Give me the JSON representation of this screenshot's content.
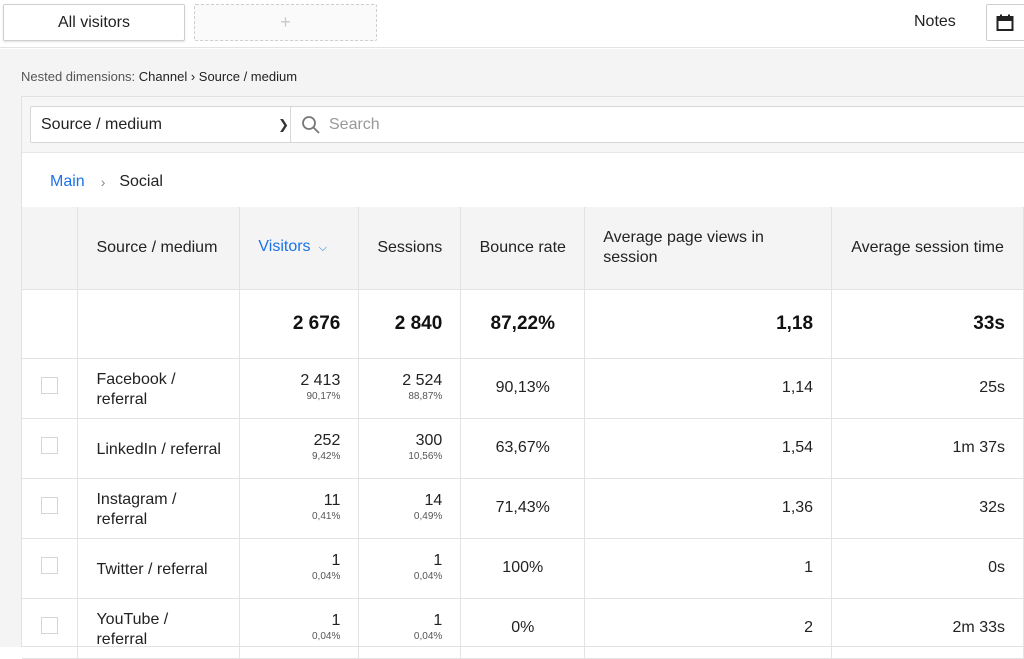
{
  "topbar": {
    "segment_label": "All visitors",
    "add_segment": "+",
    "notes_label": "Notes"
  },
  "nested": {
    "prefix": "Nested dimensions:",
    "path": "Channel › Source / medium"
  },
  "filter": {
    "dimension": "Source / medium",
    "search_placeholder": "Search"
  },
  "breadcrumb": {
    "main": "Main",
    "separator": "›",
    "current": "Social"
  },
  "table": {
    "headers": {
      "source": "Source / medium",
      "visitors": "Visitors",
      "sessions": "Sessions",
      "bounce": "Bounce rate",
      "pageviews": "Average page views in session",
      "session_time": "Average session time"
    },
    "totals": {
      "visitors": "2 676",
      "sessions": "2 840",
      "bounce": "87,22%",
      "pageviews": "1,18",
      "session_time": "33s"
    },
    "rows": [
      {
        "name": "Facebook / referral",
        "visitors": "2 413",
        "visitors_pct": "90,17%",
        "sessions": "2 524",
        "sessions_pct": "88,87%",
        "bounce": "90,13%",
        "pageviews": "1,14",
        "session_time": "25s"
      },
      {
        "name": "LinkedIn / referral",
        "visitors": "252",
        "visitors_pct": "9,42%",
        "sessions": "300",
        "sessions_pct": "10,56%",
        "bounce": "63,67%",
        "pageviews": "1,54",
        "session_time": "1m 37s"
      },
      {
        "name": "Instagram / referral",
        "visitors": "11",
        "visitors_pct": "0,41%",
        "sessions": "14",
        "sessions_pct": "0,49%",
        "bounce": "71,43%",
        "pageviews": "1,36",
        "session_time": "32s"
      },
      {
        "name": "Twitter / referral",
        "visitors": "1",
        "visitors_pct": "0,04%",
        "sessions": "1",
        "sessions_pct": "0,04%",
        "bounce": "100%",
        "pageviews": "1",
        "session_time": "0s"
      },
      {
        "name": "YouTube / referral",
        "visitors": "1",
        "visitors_pct": "0,04%",
        "sessions": "1",
        "sessions_pct": "0,04%",
        "bounce": "0%",
        "pageviews": "2",
        "session_time": "2m 33s"
      }
    ]
  },
  "colors": {
    "accent": "#1a73e8",
    "header_bg": "#f4f4f4"
  }
}
